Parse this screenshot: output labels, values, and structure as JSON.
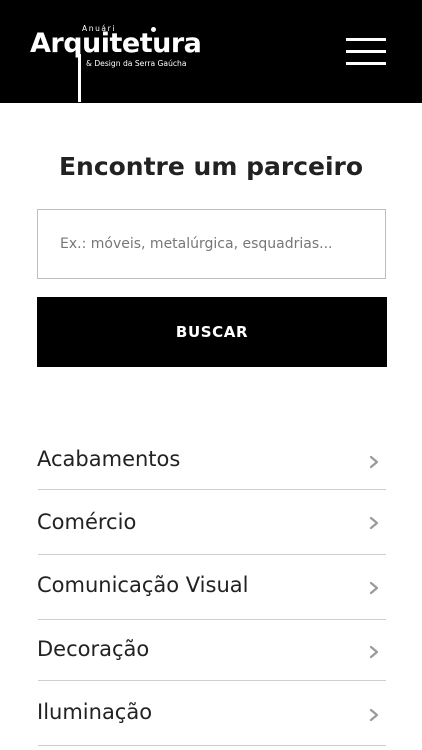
{
  "header": {
    "logo_small": "Anuári",
    "logo_main": "Arquitetura",
    "logo_sub": "& Design da Serra Gaúcha"
  },
  "search": {
    "title": "Encontre um parceiro",
    "placeholder": "Ex.: móveis, metalúrgica, esquadrias...",
    "button_label": "BUSCAR"
  },
  "categories": [
    {
      "label": "Acabamentos"
    },
    {
      "label": "Comércio"
    },
    {
      "label": "Comunicação Visual"
    },
    {
      "label": "Decoração"
    },
    {
      "label": "Iluminação"
    }
  ]
}
